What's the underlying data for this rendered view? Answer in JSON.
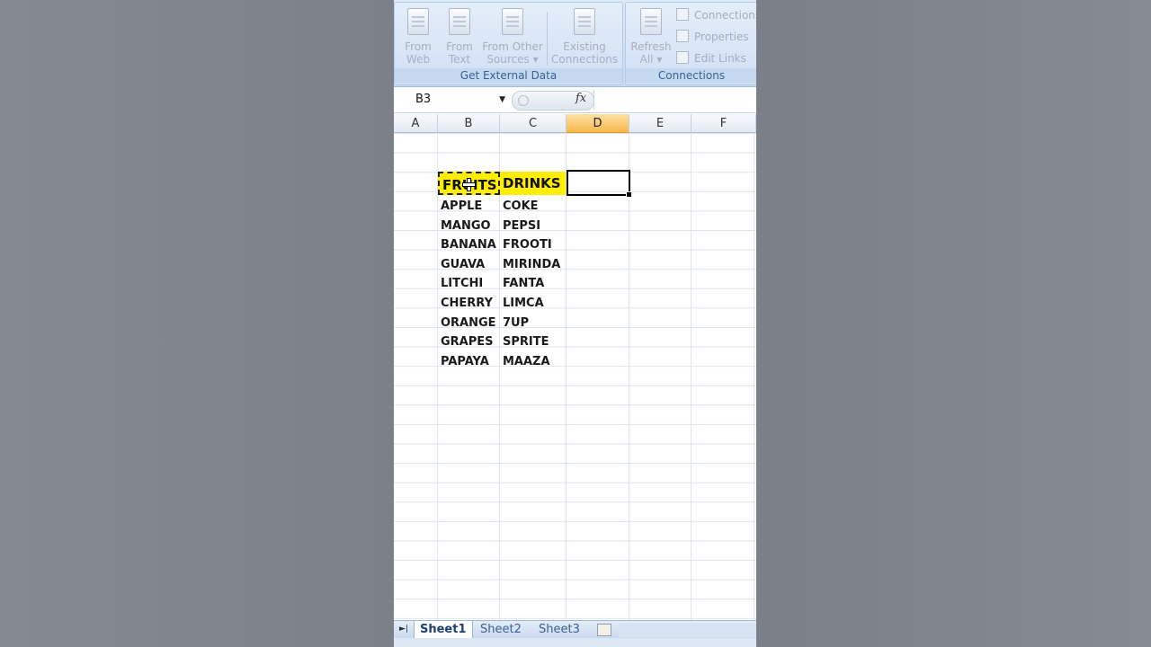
{
  "ribbon": {
    "get_external_data": {
      "label": "Get External Data",
      "buttons": [
        {
          "line1": "From",
          "line2": "Web"
        },
        {
          "line1": "From",
          "line2": "Text"
        },
        {
          "line1": "From Other",
          "line2": "Sources ▾"
        },
        {
          "line1": "Existing",
          "line2": "Connections"
        }
      ]
    },
    "connections": {
      "label": "Connections",
      "refresh": {
        "line1": "Refresh",
        "line2": "All ▾"
      },
      "small": [
        "Connections",
        "Properties",
        "Edit Links"
      ]
    }
  },
  "formula_bar": {
    "name_box": "B3",
    "fx": "fx",
    "value": ""
  },
  "columns": [
    "A",
    "B",
    "C",
    "D",
    "E",
    "F"
  ],
  "active_column": "D",
  "headers": {
    "b": "FRUITS",
    "c": "DRINKS"
  },
  "rows": [
    {
      "b": "APPLE",
      "c": "COKE"
    },
    {
      "b": "MANGO",
      "c": "PEPSI"
    },
    {
      "b": "BANANA",
      "c": "FROOTI"
    },
    {
      "b": "GUAVA",
      "c": "MIRINDA"
    },
    {
      "b": "LITCHI",
      "c": "FANTA"
    },
    {
      "b": "CHERRY",
      "c": "LIMCA"
    },
    {
      "b": "ORANGE",
      "c": "7UP"
    },
    {
      "b": "GRAPES",
      "c": "SPRITE"
    },
    {
      "b": "PAPAYA",
      "c": "MAAZA"
    }
  ],
  "sheet_tabs": [
    "Sheet1",
    "Sheet2",
    "Sheet3"
  ],
  "active_sheet": "Sheet1",
  "colors": {
    "header_fill": "#ffee00",
    "active_col": "#f7b94f",
    "ribbon": "#c6daf1"
  }
}
